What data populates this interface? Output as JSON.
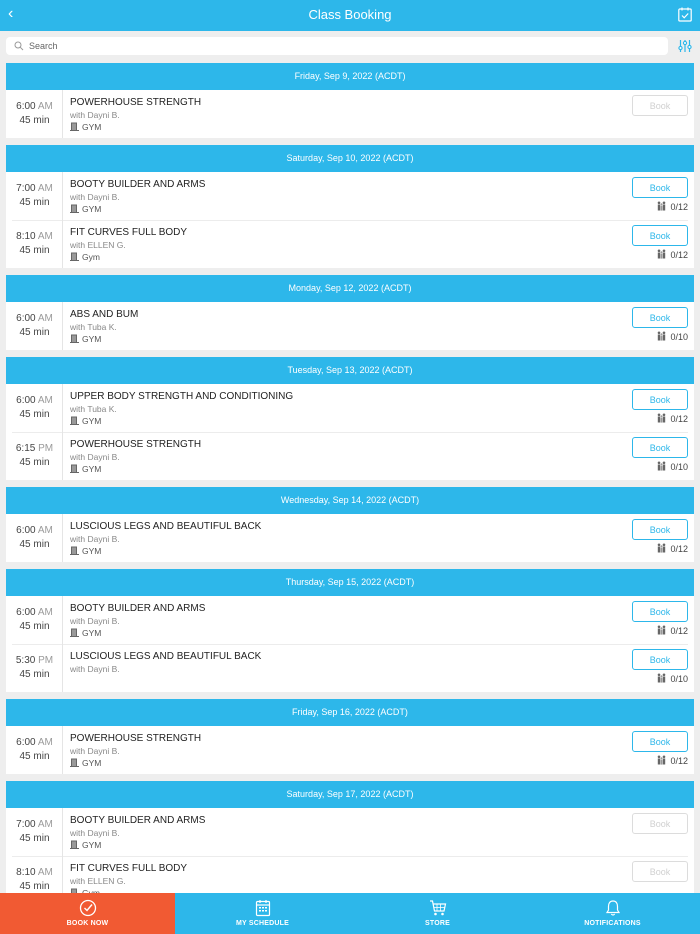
{
  "header": {
    "title": "Class Booking",
    "back_icon": "chevron-left-icon",
    "calendar_icon": "calendar-check-icon"
  },
  "search": {
    "placeholder": "Search"
  },
  "colors": {
    "accent": "#2db7ea",
    "active_tab": "#f15a33"
  },
  "days": [
    {
      "date": "Friday, Sep 9, 2022 (ACDT)",
      "classes": [
        {
          "time": "6:00",
          "ampm": "AM",
          "duration": "45 min",
          "name": "POWERHOUSE STRENGTH",
          "instructor": "with Dayni B.",
          "location": "GYM",
          "book": "Book",
          "enabled": false,
          "capacity": ""
        }
      ]
    },
    {
      "date": "Saturday, Sep 10, 2022 (ACDT)",
      "classes": [
        {
          "time": "7:00",
          "ampm": "AM",
          "duration": "45 min",
          "name": "BOOTY BUILDER AND ARMS",
          "instructor": "with Dayni B.",
          "location": "GYM",
          "book": "Book",
          "enabled": true,
          "capacity": "0/12"
        },
        {
          "time": "8:10",
          "ampm": "AM",
          "duration": "45 min",
          "name": "FIT CURVES FULL BODY",
          "instructor": "with ELLEN G.",
          "location": "Gym",
          "book": "Book",
          "enabled": true,
          "capacity": "0/12"
        }
      ]
    },
    {
      "date": "Monday, Sep 12, 2022 (ACDT)",
      "classes": [
        {
          "time": "6:00",
          "ampm": "AM",
          "duration": "45 min",
          "name": "ABS AND BUM",
          "instructor": "with Tuba K.",
          "location": "GYM",
          "book": "Book",
          "enabled": true,
          "capacity": "0/10"
        }
      ]
    },
    {
      "date": "Tuesday, Sep 13, 2022 (ACDT)",
      "classes": [
        {
          "time": "6:00",
          "ampm": "AM",
          "duration": "45 min",
          "name": "UPPER BODY STRENGTH AND CONDITIONING",
          "instructor": "with Tuba K.",
          "location": "GYM",
          "book": "Book",
          "enabled": true,
          "capacity": "0/12"
        },
        {
          "time": "6:15",
          "ampm": "PM",
          "duration": "45 min",
          "name": "POWERHOUSE STRENGTH",
          "instructor": "with Dayni B.",
          "location": "GYM",
          "book": "Book",
          "enabled": true,
          "capacity": "0/10"
        }
      ]
    },
    {
      "date": "Wednesday, Sep 14, 2022 (ACDT)",
      "classes": [
        {
          "time": "6:00",
          "ampm": "AM",
          "duration": "45 min",
          "name": "LUSCIOUS LEGS AND BEAUTIFUL BACK",
          "instructor": "with Dayni B.",
          "location": "GYM",
          "book": "Book",
          "enabled": true,
          "capacity": "0/12"
        }
      ]
    },
    {
      "date": "Thursday, Sep 15, 2022 (ACDT)",
      "classes": [
        {
          "time": "6:00",
          "ampm": "AM",
          "duration": "45 min",
          "name": "BOOTY BUILDER AND ARMS",
          "instructor": "with Dayni B.",
          "location": "GYM",
          "book": "Book",
          "enabled": true,
          "capacity": "0/12"
        },
        {
          "time": "5:30",
          "ampm": "PM",
          "duration": "45 min",
          "name": "LUSCIOUS LEGS AND BEAUTIFUL BACK",
          "instructor": "with Dayni B.",
          "location": "",
          "book": "Book",
          "enabled": true,
          "capacity": "0/10"
        }
      ]
    },
    {
      "date": "Friday, Sep 16, 2022 (ACDT)",
      "classes": [
        {
          "time": "6:00",
          "ampm": "AM",
          "duration": "45 min",
          "name": "POWERHOUSE STRENGTH",
          "instructor": "with Dayni B.",
          "location": "GYM",
          "book": "Book",
          "enabled": true,
          "capacity": "0/12"
        }
      ]
    },
    {
      "date": "Saturday, Sep 17, 2022 (ACDT)",
      "classes": [
        {
          "time": "7:00",
          "ampm": "AM",
          "duration": "45 min",
          "name": "BOOTY BUILDER AND ARMS",
          "instructor": "with Dayni B.",
          "location": "GYM",
          "book": "Book",
          "enabled": false,
          "capacity": ""
        },
        {
          "time": "8:10",
          "ampm": "AM",
          "duration": "45 min",
          "name": "FIT CURVES FULL BODY",
          "instructor": "with ELLEN G.",
          "location": "Gym",
          "book": "Book",
          "enabled": false,
          "capacity": ""
        }
      ]
    }
  ],
  "tabs": [
    {
      "label": "BOOK NOW",
      "icon": "check-circle-icon",
      "active": true
    },
    {
      "label": "MY SCHEDULE",
      "icon": "schedule-icon",
      "active": false
    },
    {
      "label": "STORE",
      "icon": "cart-icon",
      "active": false
    },
    {
      "label": "NOTIFICATIONS",
      "icon": "bell-icon",
      "active": false
    }
  ]
}
